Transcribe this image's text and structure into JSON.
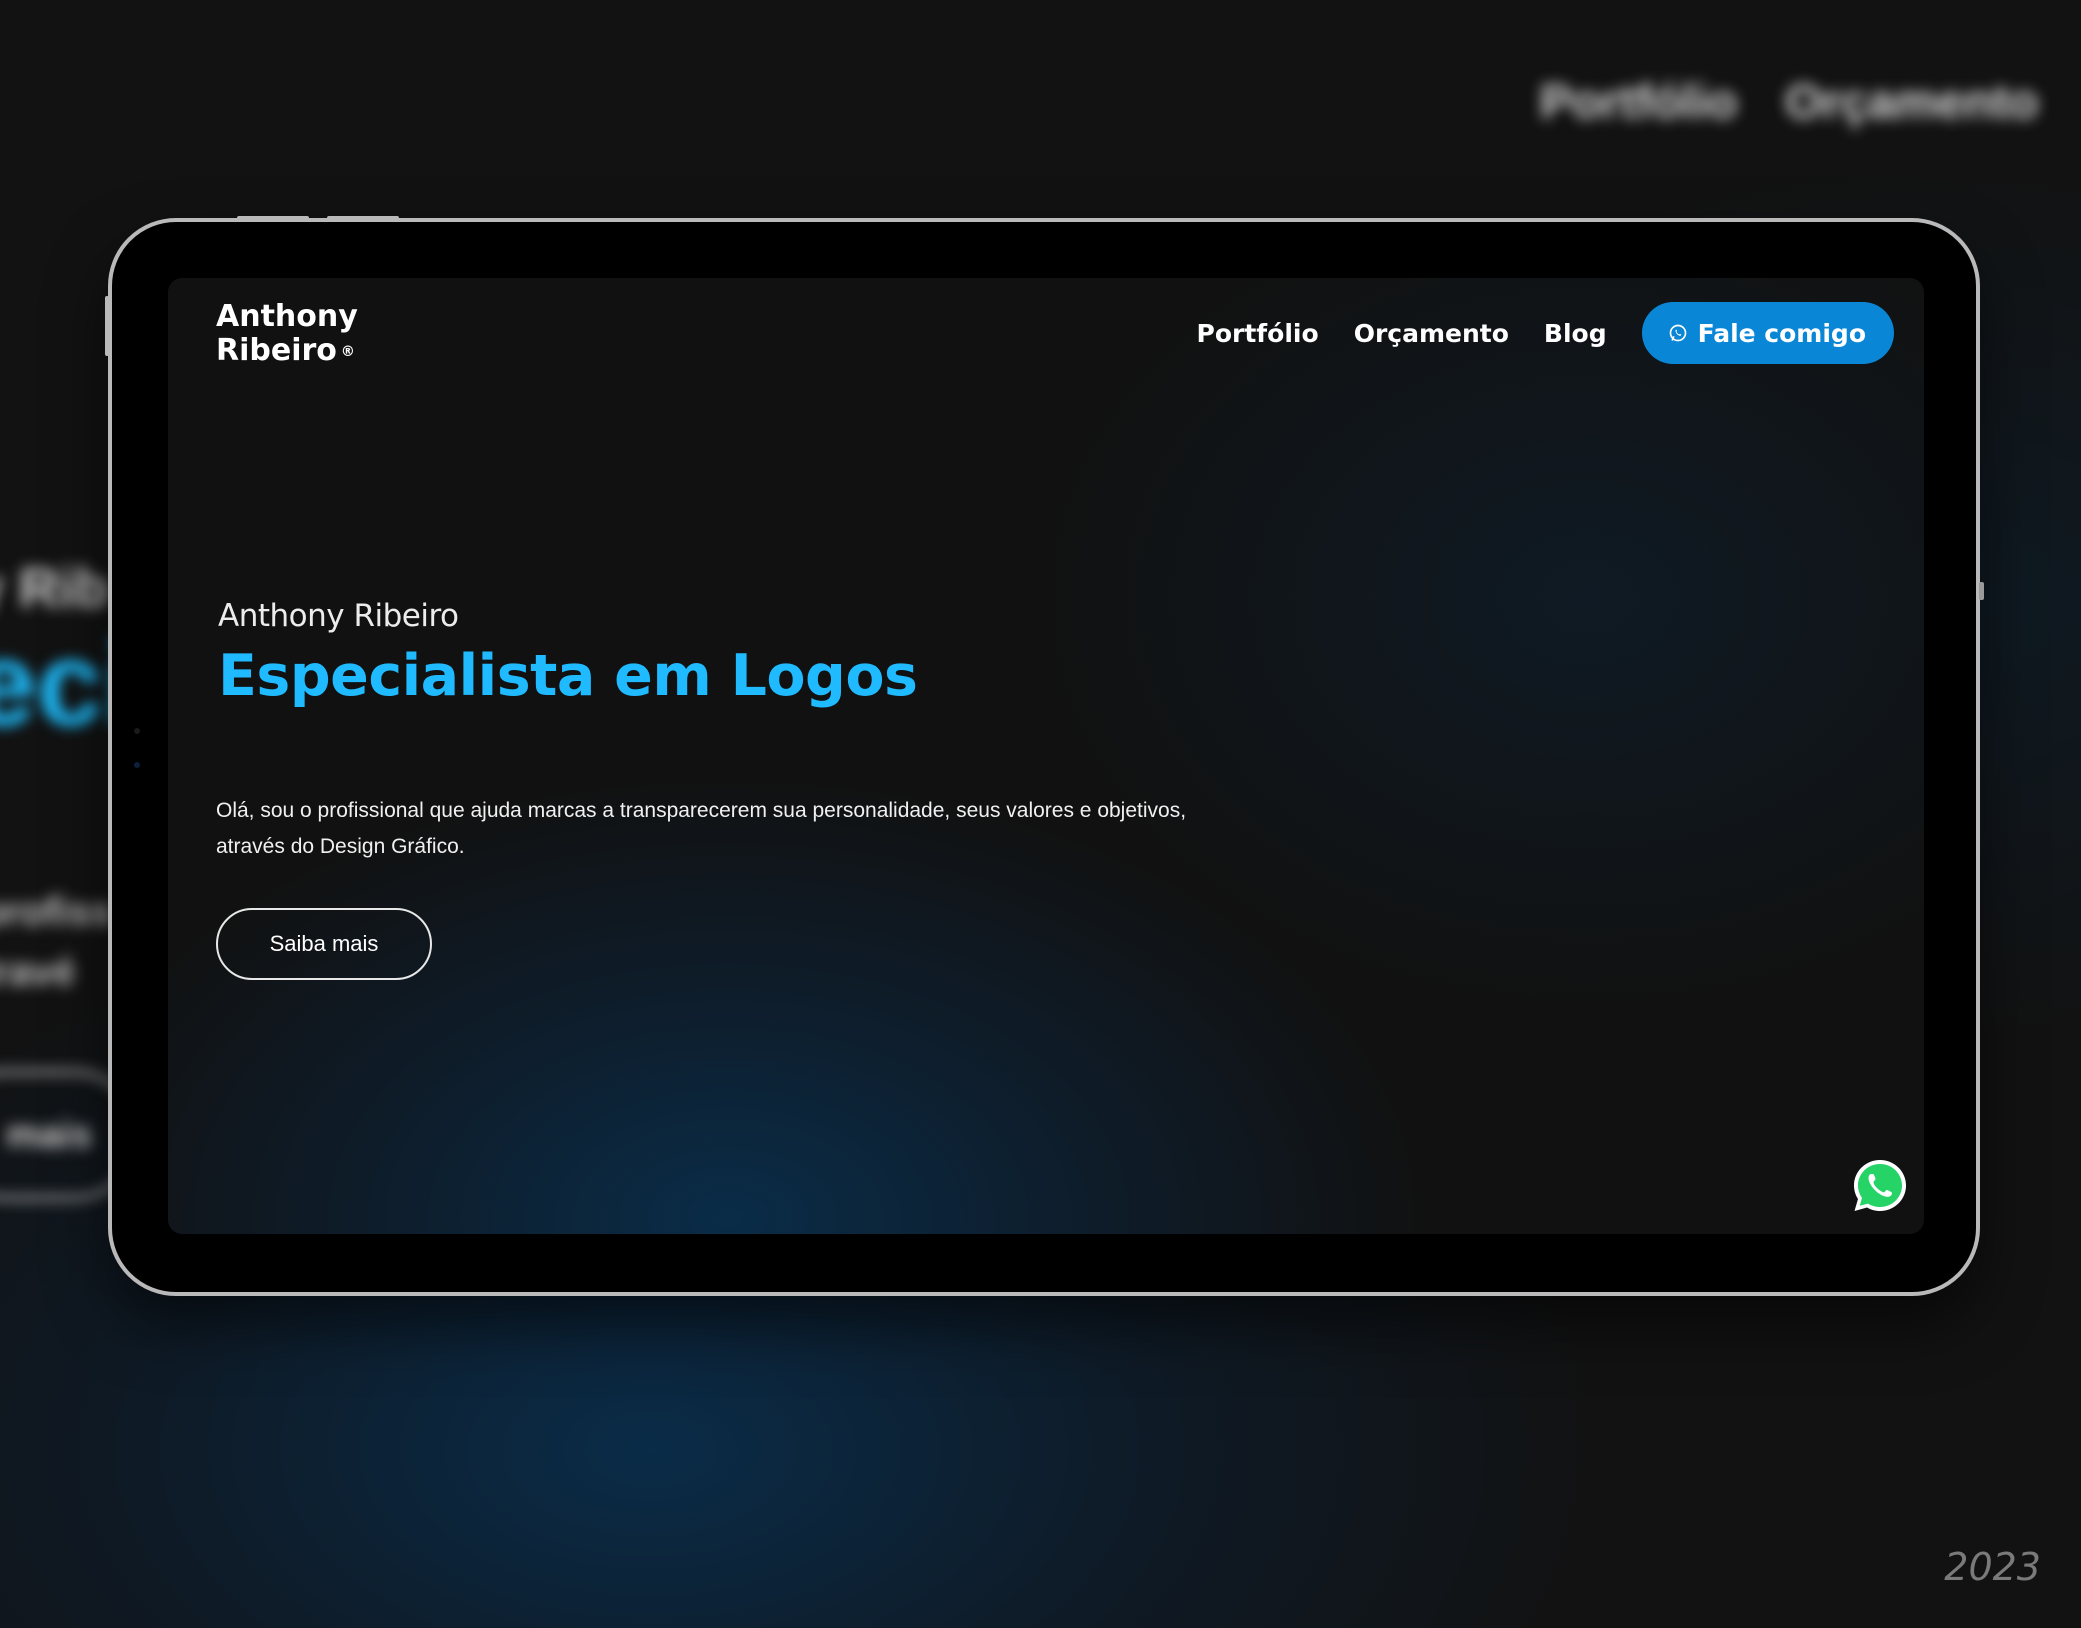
{
  "background_page": {
    "nav": [
      "Portfólio",
      "Orçamento"
    ],
    "name_fragment": "y Rib",
    "headline_fragment": "eci",
    "text_lines": [
      "profiss",
      "travé"
    ],
    "button_fragment": "mais"
  },
  "site": {
    "logo": {
      "line1": "Anthony",
      "line2": "Ribeiro",
      "mark": "®"
    },
    "nav": {
      "portfolio": "Portfólio",
      "orcamento": "Orçamento",
      "blog": "Blog",
      "cta": "Fale comigo"
    },
    "hero": {
      "name": "Anthony Ribeiro",
      "title": "Especialista em Logos",
      "description": "Olá, sou o profissional que ajuda marcas a transparecerem sua personalidade, seus valores e objetivos, através do Design Gráfico.",
      "button": "Saiba mais"
    }
  },
  "year": "2023",
  "colors": {
    "accent": "#1fbaff",
    "cta_background": "#0a86d6",
    "whatsapp_green": "#25d366",
    "page_background": "#111111"
  },
  "icons": {
    "cta_icon": "whatsapp-icon",
    "floating_button": "whatsapp-icon"
  }
}
